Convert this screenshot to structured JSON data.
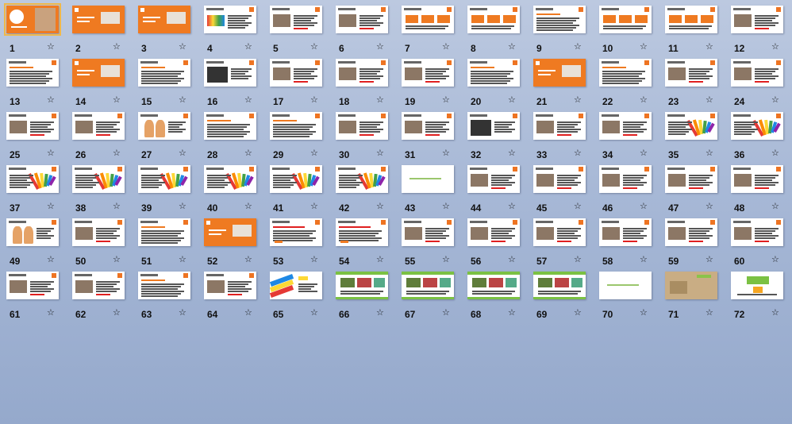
{
  "slides": [
    {
      "n": "1",
      "t": "title"
    },
    {
      "n": "2",
      "t": "orange"
    },
    {
      "n": "3",
      "t": "orange"
    },
    {
      "n": "4",
      "t": "mixed"
    },
    {
      "n": "5",
      "t": "photo"
    },
    {
      "n": "6",
      "t": "photo"
    },
    {
      "n": "7",
      "t": "boxes"
    },
    {
      "n": "8",
      "t": "boxes"
    },
    {
      "n": "9",
      "t": "text"
    },
    {
      "n": "10",
      "t": "boxes"
    },
    {
      "n": "11",
      "t": "boxes"
    },
    {
      "n": "12",
      "t": "photo"
    },
    {
      "n": "13",
      "t": "text"
    },
    {
      "n": "14",
      "t": "orange"
    },
    {
      "n": "15",
      "t": "text"
    },
    {
      "n": "16",
      "t": "dark"
    },
    {
      "n": "17",
      "t": "photo"
    },
    {
      "n": "18",
      "t": "photo"
    },
    {
      "n": "19",
      "t": "photo"
    },
    {
      "n": "20",
      "t": "text"
    },
    {
      "n": "21",
      "t": "orange"
    },
    {
      "n": "22",
      "t": "text"
    },
    {
      "n": "23",
      "t": "photo"
    },
    {
      "n": "24",
      "t": "photo"
    },
    {
      "n": "25",
      "t": "photo"
    },
    {
      "n": "26",
      "t": "photo"
    },
    {
      "n": "27",
      "t": "figure"
    },
    {
      "n": "28",
      "t": "text"
    },
    {
      "n": "29",
      "t": "text"
    },
    {
      "n": "30",
      "t": "photo"
    },
    {
      "n": "31",
      "t": "photo"
    },
    {
      "n": "32",
      "t": "dark"
    },
    {
      "n": "33",
      "t": "photo"
    },
    {
      "n": "34",
      "t": "photo"
    },
    {
      "n": "35",
      "t": "fan"
    },
    {
      "n": "36",
      "t": "fan"
    },
    {
      "n": "37",
      "t": "fan"
    },
    {
      "n": "38",
      "t": "fan"
    },
    {
      "n": "39",
      "t": "fan"
    },
    {
      "n": "40",
      "t": "fan"
    },
    {
      "n": "41",
      "t": "fan"
    },
    {
      "n": "42",
      "t": "fan"
    },
    {
      "n": "43",
      "t": "blank"
    },
    {
      "n": "44",
      "t": "photo"
    },
    {
      "n": "45",
      "t": "photo"
    },
    {
      "n": "46",
      "t": "photo"
    },
    {
      "n": "47",
      "t": "photo"
    },
    {
      "n": "48",
      "t": "photo"
    },
    {
      "n": "49",
      "t": "figure"
    },
    {
      "n": "50",
      "t": "photo"
    },
    {
      "n": "51",
      "t": "text"
    },
    {
      "n": "52",
      "t": "orange"
    },
    {
      "n": "53",
      "t": "red"
    },
    {
      "n": "54",
      "t": "red"
    },
    {
      "n": "55",
      "t": "photo"
    },
    {
      "n": "56",
      "t": "photo"
    },
    {
      "n": "57",
      "t": "photo"
    },
    {
      "n": "58",
      "t": "photo"
    },
    {
      "n": "59",
      "t": "photo"
    },
    {
      "n": "60",
      "t": "photo"
    },
    {
      "n": "61",
      "t": "photo"
    },
    {
      "n": "62",
      "t": "photo"
    },
    {
      "n": "63",
      "t": "text"
    },
    {
      "n": "64",
      "t": "photo"
    },
    {
      "n": "65",
      "t": "stripes"
    },
    {
      "n": "66",
      "t": "green"
    },
    {
      "n": "67",
      "t": "green"
    },
    {
      "n": "68",
      "t": "green"
    },
    {
      "n": "69",
      "t": "green"
    },
    {
      "n": "70",
      "t": "blank"
    },
    {
      "n": "71",
      "t": "beige"
    },
    {
      "n": "72",
      "t": "greenlogo"
    }
  ],
  "selected_slide": "1",
  "star_glyph": "☆",
  "colors": {
    "accent": "#ef7a21",
    "selection": "#f0b84a",
    "background": "#a7b8d6"
  }
}
